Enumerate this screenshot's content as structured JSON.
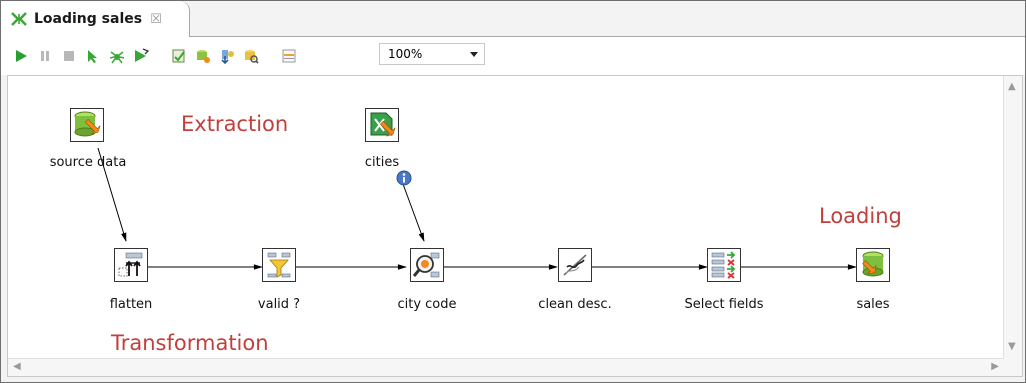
{
  "tab": {
    "title": "Loading sales",
    "close_icon": "close-icon"
  },
  "toolbar": {
    "buttons": [
      "run-icon",
      "pause-icon",
      "stop-icon",
      "preview-icon",
      "debug-icon",
      "replay-icon",
      "verify-icon",
      "impact-icon",
      "sql-icon",
      "explore-db-icon",
      "show-results-icon"
    ],
    "zoom": "100%"
  },
  "canvas": {
    "sections": {
      "extraction": "Extraction",
      "loading": "Loading",
      "transformation": "Transformation"
    },
    "steps": {
      "source_data": "source data",
      "cities": "cities",
      "flatten": "flatten",
      "valid": "valid ?",
      "city_code": "city code",
      "clean_desc": "clean desc.",
      "select_fields": "Select fields",
      "sales": "sales"
    }
  },
  "colors": {
    "section_text": "#c0403c",
    "hop": "#000000",
    "db_green": "#7fbf3f",
    "db_orange": "#f08a1c"
  }
}
